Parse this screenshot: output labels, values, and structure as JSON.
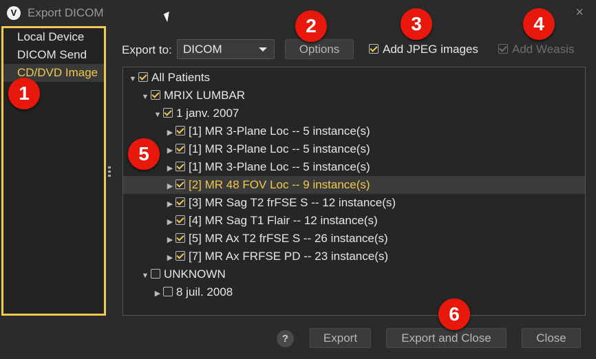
{
  "window": {
    "title": "Export DICOM",
    "logo": "V",
    "close_icon": "×"
  },
  "sidebar": {
    "items": [
      {
        "label": "Local Device"
      },
      {
        "label": "DICOM Send"
      },
      {
        "label": "CD/DVD Image",
        "selected": true
      }
    ]
  },
  "toolbar": {
    "export_to_label": "Export to:",
    "export_to_value": "DICOM",
    "options_label": "Options",
    "add_jpeg_label": "Add JPEG images",
    "add_jpeg_checked": true,
    "add_weasis_label": "Add Weasis",
    "add_weasis_checked": true,
    "add_weasis_disabled": true
  },
  "tree": {
    "rows": [
      {
        "label": "All Patients",
        "expanded": true,
        "checked": true
      },
      {
        "label": "MRIX LUMBAR",
        "expanded": true,
        "checked": true
      },
      {
        "label": "1 janv. 2007",
        "expanded": true,
        "checked": true
      },
      {
        "label": "[1] MR 3-Plane Loc -- 5 instance(s)",
        "checked": true
      },
      {
        "label": "[1] MR 3-Plane Loc -- 5 instance(s)",
        "checked": true
      },
      {
        "label": "[1] MR 3-Plane Loc -- 5 instance(s)",
        "checked": true
      },
      {
        "label": "[2] MR 48 FOV Loc -- 9 instance(s)",
        "checked": true,
        "highlighted": true
      },
      {
        "label": "[3] MR Sag T2 frFSE S -- 12 instance(s)",
        "checked": true
      },
      {
        "label": "[4] MR Sag T1 Flair -- 12 instance(s)",
        "checked": true
      },
      {
        "label": "[5] MR Ax T2 frFSE S -- 26 instance(s)",
        "checked": true
      },
      {
        "label": "[7] MR Ax FRFSE PD -- 23 instance(s)",
        "checked": true
      },
      {
        "label": "UNKNOWN",
        "expanded": true,
        "checked": false
      },
      {
        "label": "8 juil. 2008",
        "expanded": false,
        "checked": false
      }
    ]
  },
  "footer": {
    "help_label": "?",
    "export_label": "Export",
    "export_close_label": "Export and Close",
    "close_label": "Close"
  },
  "annotations": {
    "b1": "1",
    "b2": "2",
    "b3": "3",
    "b4": "4",
    "b5": "5",
    "b6": "6"
  },
  "colors": {
    "accent": "#f2c94c",
    "badge": "#e8180c",
    "background": "#2b2b2b"
  }
}
